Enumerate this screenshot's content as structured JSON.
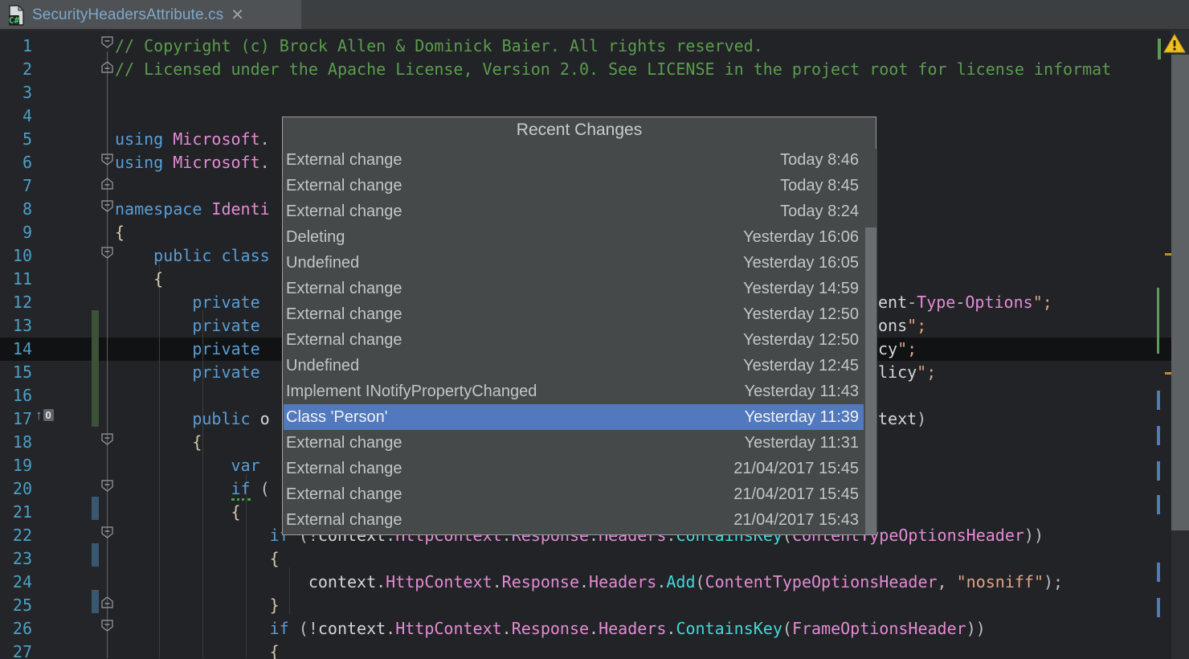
{
  "window": {
    "tab": {
      "title": "SecurityHeadersAttribute.cs",
      "icon": "csharp-file-icon",
      "close_glyph": "✕",
      "language_badge": "C#"
    }
  },
  "editor": {
    "current_line": 14,
    "first_line": 1,
    "last_line": 27,
    "warning_icon": "warning-triangle-icon",
    "usage_badge": {
      "line": 17,
      "arrow": "↑",
      "count": "0"
    },
    "lines": [
      {
        "n": 1,
        "text": "// Copyright (c) Brock Allen & Dominick Baier. All rights reserved."
      },
      {
        "n": 2,
        "text": "// Licensed under the Apache License, Version 2.0. See LICENSE in the project root for license informat"
      },
      {
        "n": 3,
        "text": ""
      },
      {
        "n": 4,
        "text": ""
      },
      {
        "n": 5,
        "text": "using Microsoft."
      },
      {
        "n": 6,
        "text": "using Microsoft."
      },
      {
        "n": 7,
        "text": ""
      },
      {
        "n": 8,
        "text": "namespace Identi"
      },
      {
        "n": 9,
        "text": "{"
      },
      {
        "n": 10,
        "text": "    public class"
      },
      {
        "n": 11,
        "text": "    {"
      },
      {
        "n": 12,
        "text": "        private"
      },
      {
        "n": 13,
        "text": "        private"
      },
      {
        "n": 14,
        "text": "        private"
      },
      {
        "n": 15,
        "text": "        private"
      },
      {
        "n": 16,
        "text": ""
      },
      {
        "n": 17,
        "text": "        public o"
      },
      {
        "n": 18,
        "text": "        {"
      },
      {
        "n": 19,
        "text": "            var"
      },
      {
        "n": 20,
        "text": "            if ("
      },
      {
        "n": 21,
        "text": "            {"
      },
      {
        "n": 22,
        "text": "                if (!context.HttpContext.Response.Headers.ContainsKey(ContentTypeOptionsHeader))"
      },
      {
        "n": 23,
        "text": "                {"
      },
      {
        "n": 24,
        "text": "                    context.HttpContext.Response.Headers.Add(ContentTypeOptionsHeader, \"nosniff\");"
      },
      {
        "n": 25,
        "text": "                }"
      },
      {
        "n": 26,
        "text": "                if (!context.HttpContext.Response.Headers.ContainsKey(FrameOptionsHeader))"
      },
      {
        "n": 27,
        "text": "                {"
      }
    ],
    "right_fragments": [
      {
        "line": 12,
        "text": "ent-Type-Options\";"
      },
      {
        "line": 13,
        "text": "ons\";"
      },
      {
        "line": 14,
        "text": "cy\";"
      },
      {
        "line": 15,
        "text": "licy\";"
      },
      {
        "line": 17,
        "text": "text)"
      }
    ]
  },
  "popup": {
    "title": "Recent Changes",
    "selected_index": 10,
    "rows": [
      {
        "label": "External change",
        "time": "Today 8:46"
      },
      {
        "label": "External change",
        "time": "Today 8:45"
      },
      {
        "label": "External change",
        "time": "Today 8:24"
      },
      {
        "label": "Deleting",
        "time": "Yesterday 16:06"
      },
      {
        "label": "Undefined",
        "time": "Yesterday 16:05"
      },
      {
        "label": "External change",
        "time": "Yesterday 14:59"
      },
      {
        "label": "External change",
        "time": "Yesterday 12:50"
      },
      {
        "label": "External change",
        "time": "Yesterday 12:50"
      },
      {
        "label": "Undefined",
        "time": "Yesterday 12:45"
      },
      {
        "label": "Implement INotifyPropertyChanged",
        "time": "Yesterday 11:43"
      },
      {
        "label": "Class 'Person'",
        "time": "Yesterday 11:39"
      },
      {
        "label": "External change",
        "time": "Yesterday 11:31"
      },
      {
        "label": "External change",
        "time": "21/04/2017 15:45"
      },
      {
        "label": "External change",
        "time": "21/04/2017 15:45"
      },
      {
        "label": "External change",
        "time": "21/04/2017 15:43"
      }
    ]
  },
  "colors": {
    "editor_bg": "#212326",
    "gutter_bg": "#232528",
    "tab_bar_bg": "#3c3f41",
    "tab_active_bg": "#4e5254",
    "tab_title": "#7fa7cc",
    "line_number": "#4d9fc5",
    "comment": "#5b9c4e",
    "keyword": "#5a9ed6",
    "string": "#e0a485",
    "property": "#e48bd4",
    "method": "#42d8d8",
    "popup_bg": "#45494a",
    "popup_border": "#9a9d9f",
    "selection": "#5279bd",
    "current_line": "#111214",
    "added_gutter": "#3b5138",
    "modified_gutter": "#3a5772",
    "warning": "#f0c020",
    "error_marker": "#c08a30"
  }
}
